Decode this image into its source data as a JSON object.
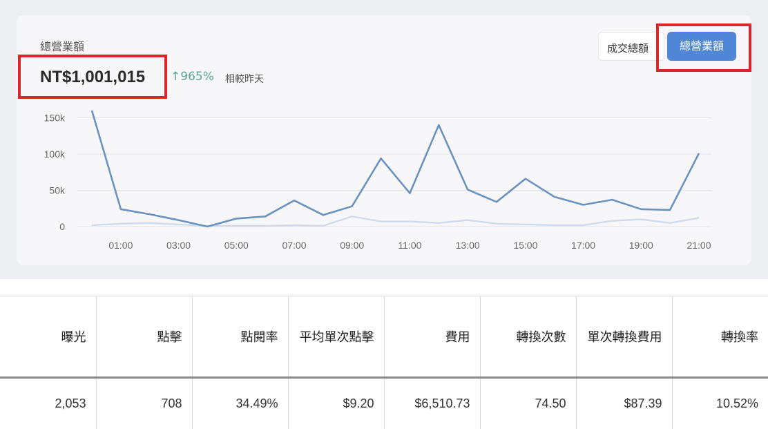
{
  "card": {
    "title": "總營業額",
    "total_value": "NT$1,001,015",
    "growth_arrow": "↑",
    "growth_text": "965%",
    "compare_text": "相較昨天"
  },
  "toggle": {
    "orders_label": "成交總額",
    "revenue_label": "總營業額"
  },
  "colors": {
    "accent": "#4f86d6",
    "main_line": "#6a92bf",
    "secondary_line": "#cfdbed",
    "growth": "#5aa58c",
    "highlight": "#d8262c"
  },
  "chart_data": {
    "type": "line",
    "x": [
      "00:00",
      "01:00",
      "02:00",
      "03:00",
      "04:00",
      "05:00",
      "06:00",
      "07:00",
      "08:00",
      "09:00",
      "10:00",
      "11:00",
      "12:00",
      "13:00",
      "14:00",
      "15:00",
      "16:00",
      "17:00",
      "18:00",
      "19:00",
      "20:00",
      "21:00"
    ],
    "x_tick_labels": [
      "01:00",
      "03:00",
      "05:00",
      "07:00",
      "09:00",
      "11:00",
      "13:00",
      "15:00",
      "17:00",
      "19:00",
      "21:00"
    ],
    "y_tick_labels": [
      "0",
      "50k",
      "100k",
      "150k"
    ],
    "y_ticks": [
      0,
      50000,
      100000,
      150000
    ],
    "ylim": [
      0,
      160000
    ],
    "grid": true,
    "series": [
      {
        "values": [
          160000,
          24000,
          17000,
          9000,
          0,
          11000,
          14000,
          36000,
          16000,
          28000,
          94000,
          46000,
          140000,
          51000,
          34000,
          66000,
          41000,
          30000,
          37000,
          24000,
          23000,
          101000
        ]
      },
      {
        "values": [
          2000,
          4000,
          5000,
          3000,
          1000,
          1000,
          1000,
          2000,
          1000,
          14000,
          7000,
          7000,
          5000,
          9000,
          4000,
          3000,
          2000,
          2000,
          8000,
          10000,
          5000,
          12000
        ]
      }
    ]
  },
  "table": {
    "headers": [
      "曝光",
      "點擊",
      "點閱率",
      "平均單次點擊",
      "費用",
      "轉換次數",
      "單次轉換費用",
      "轉換率"
    ],
    "row": [
      "2,053",
      "708",
      "34.49%",
      "$9.20",
      "$6,510.73",
      "74.50",
      "$87.39",
      "10.52%"
    ]
  }
}
